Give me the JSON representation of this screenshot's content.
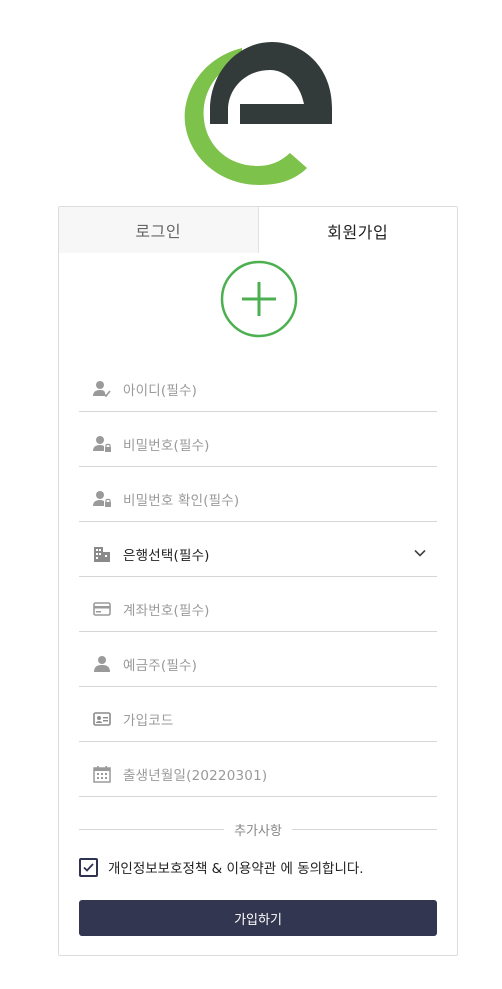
{
  "brand": {
    "accent_green": "#7dc24b",
    "logo_dark": "#333a3a",
    "button_color": "#323650"
  },
  "tabs": [
    {
      "label": "로그인",
      "active": false
    },
    {
      "label": "회원가입",
      "active": true
    }
  ],
  "form": {
    "fields": [
      {
        "icon": "user-check-icon",
        "placeholder": "아이디(필수)"
      },
      {
        "icon": "user-lock-icon",
        "placeholder": "비밀번호(필수)"
      },
      {
        "icon": "user-lock-icon",
        "placeholder": "비밀번호 확인(필수)"
      },
      {
        "icon": "building-icon",
        "value": "은행선택(필수)",
        "dropdown": true
      },
      {
        "icon": "credit-card-icon",
        "placeholder": "계좌번호(필수)"
      },
      {
        "icon": "user-icon",
        "placeholder": "예금주(필수)"
      },
      {
        "icon": "id-card-icon",
        "placeholder": "가입코드"
      },
      {
        "icon": "calendar-icon",
        "placeholder": "출생년월일(20220301)"
      }
    ],
    "divider_label": "추가사항",
    "agree": {
      "checked": true,
      "text_part1": "개인정보보호정책",
      "amp": " & ",
      "text_part2": "이용약관",
      "text_part3": " 에 동의합니다."
    },
    "submit_label": "가입하기"
  }
}
